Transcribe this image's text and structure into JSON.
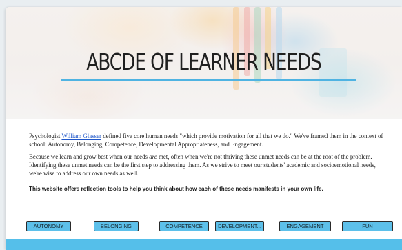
{
  "hero": {
    "title": "ABCDE OF LEARNER NEEDS"
  },
  "intro": {
    "p1_before_link": "Psychologist ",
    "p1_link": "William Glasser",
    "p1_after_link": " defined five core human needs \"which provide motivation for all that we do.\" We've framed them in the context of school: Autonomy, Belonging, Competence, Developmental Appropriateness, and Engagement.",
    "p2_before_em": "Because we learn and grow best when our needs ",
    "p2_em": "are",
    "p2_after_em": " met, often when we're not thriving these unmet needs can be at the root of the problem. Identifying these unmet needs can be the first step to addressing them. As we strive to meet our students' academic and socioemotional needs, we're wise to address our own needs as well.",
    "p3": "This website offers reflection tools to help you think about how each of these needs manifests in your own life."
  },
  "needs": [
    {
      "label": "AUTONOMY"
    },
    {
      "label": "BELONGING"
    },
    {
      "label": "COMPETENCE"
    },
    {
      "label": "DEVELOPMENT..."
    },
    {
      "label": "ENGAGEMENT"
    },
    {
      "label": "FUN"
    }
  ],
  "colors": {
    "accent": "#4fb3e2",
    "button": "#5dc0ea",
    "link": "#1e56c9"
  }
}
